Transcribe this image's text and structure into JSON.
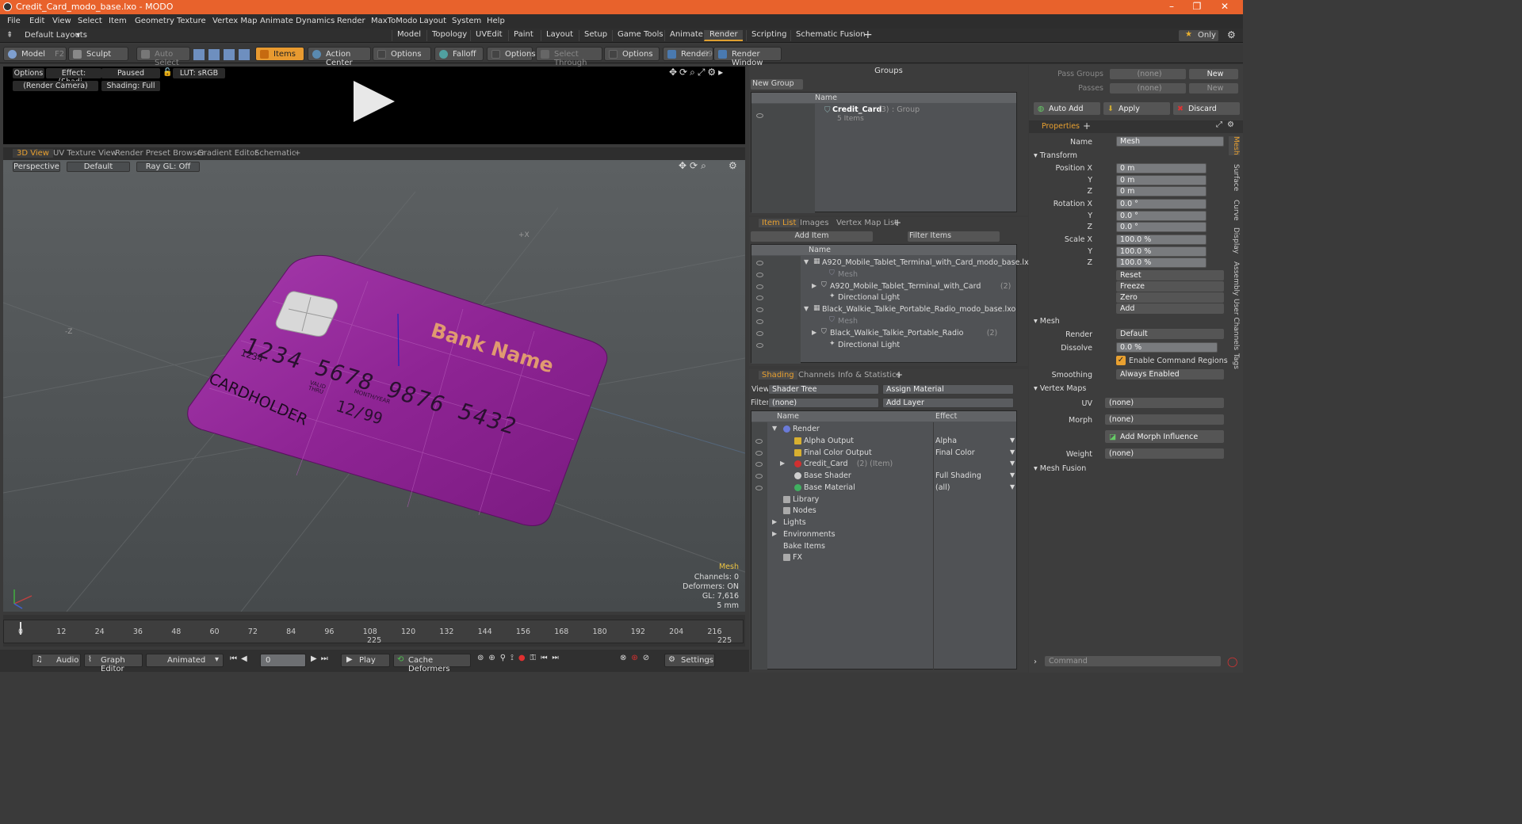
{
  "window": {
    "title": "Credit_Card_modo_base.lxo - MODO"
  },
  "menu": [
    "File",
    "Edit",
    "View",
    "Select",
    "Item",
    "Geometry",
    "Texture",
    "Vertex Map",
    "Animate",
    "Dynamics",
    "Render",
    "MaxToModo",
    "Layout",
    "System",
    "Help"
  ],
  "layout": {
    "preset": "Default Layouts",
    "tabs": [
      "Model",
      "Topology",
      "UVEdit",
      "Paint",
      "Layout",
      "Setup",
      "Game Tools",
      "Animate",
      "Render",
      "Scripting",
      "Schematic Fusion"
    ],
    "active_tab": "Render",
    "only_label": "Only"
  },
  "toolbar": {
    "model": "Model",
    "model_key": "F2",
    "sculpt": "Sculpt",
    "auto_select": "Auto Select",
    "items": "Items",
    "action_center": "Action Center",
    "options1": "Options",
    "falloff": "Falloff",
    "options2": "Options",
    "select_through": "Select Through",
    "options3": "Options",
    "render": "Render",
    "render_key": "F9",
    "render_window": "Render Window"
  },
  "preview": {
    "options": "Options",
    "effect": "Effect: (Shadi...",
    "paused": "Paused",
    "lut": "LUT: sRGB",
    "camera": "(Render Camera)",
    "shading": "Shading: Full"
  },
  "viewport_tabs": [
    "3D View",
    "UV Texture View",
    "Render Preset Browser",
    "Gradient Editor",
    "Schematic"
  ],
  "viewport": {
    "perspective": "Perspective",
    "default": "Default",
    "raygl": "Ray GL: Off",
    "card": {
      "bank": "Bank Name",
      "number": "1234 5678 9876 5432",
      "small": "1234",
      "valid": "VALID\nTHRU",
      "expiry_label": "MONTH/YEAR",
      "expiry": "12/99",
      "holder": "CARDHOLDER",
      "color": "#9a2aa0"
    },
    "stats": {
      "type": "Mesh",
      "channels": "Channels: 0",
      "deformers": "Deformers: ON",
      "gl": "GL: 7,616",
      "unit": "5 mm"
    }
  },
  "timeline": {
    "ticks": [
      "0",
      "12",
      "24",
      "36",
      "48",
      "60",
      "72",
      "84",
      "96",
      "108",
      "120",
      "132",
      "144",
      "156",
      "168",
      "180",
      "192",
      "204",
      "216"
    ],
    "mid": "225",
    "end": "225"
  },
  "bottom": {
    "audio": "Audio",
    "graph": "Graph Editor",
    "animated": "Animated",
    "frame": "0",
    "play": "Play",
    "cache": "Cache Deformers",
    "settings": "Settings"
  },
  "groups": {
    "title": "Groups",
    "new_group": "New Group",
    "col": "Name",
    "item": "Credit_Card",
    "count": "(3)",
    "type": ": Group",
    "items": "5 Items"
  },
  "itemlist": {
    "tabs": [
      "Item List",
      "Images",
      "Vertex Map List"
    ],
    "add_item": "Add Item",
    "filter": "Filter Items",
    "col": "Name",
    "rows": [
      {
        "label": "A920_Mobile_Tablet_Terminal_with_Card_modo_base.lxo",
        "indent": 0
      },
      {
        "label": "Mesh",
        "indent": 2,
        "dim": true
      },
      {
        "label": "A920_Mobile_Tablet_Terminal_with_Card",
        "extra": "(2)",
        "indent": 1
      },
      {
        "label": "Directional Light",
        "indent": 2
      },
      {
        "label": "Black_Walkie_Talkie_Portable_Radio_modo_base.lxo",
        "indent": 0
      },
      {
        "label": "Mesh",
        "indent": 2,
        "dim": true
      },
      {
        "label": "Black_Walkie_Talkie_Portable_Radio",
        "extra": "(2)",
        "indent": 1
      },
      {
        "label": "Directional Light",
        "indent": 2
      }
    ]
  },
  "shading": {
    "tabs": [
      "Shading",
      "Channels",
      "Info & Statistics"
    ],
    "view_label": "View",
    "view": "Shader Tree",
    "assign": "Assign Material",
    "filter_label": "Filter",
    "filter": "(none)",
    "add_layer": "Add Layer",
    "col_name": "Name",
    "col_effect": "Effect",
    "rows": [
      {
        "label": "Render",
        "effect": "",
        "indent": 0
      },
      {
        "label": "Alpha Output",
        "effect": "Alpha",
        "indent": 1
      },
      {
        "label": "Final Color Output",
        "effect": "Final Color",
        "indent": 1
      },
      {
        "label": "Credit_Card",
        "extra": "(2) (Item)",
        "effect": "",
        "indent": 1
      },
      {
        "label": "Base Shader",
        "effect": "Full Shading",
        "indent": 1
      },
      {
        "label": "Base Material",
        "effect": "(all)",
        "indent": 1
      },
      {
        "label": "Library",
        "effect": "",
        "indent": 0
      },
      {
        "label": "Nodes",
        "effect": "",
        "indent": 0
      },
      {
        "label": "Lights",
        "effect": "",
        "indent": -1
      },
      {
        "label": "Environments",
        "effect": "",
        "indent": -1
      },
      {
        "label": "Bake Items",
        "effect": "",
        "indent": -1
      },
      {
        "label": "FX",
        "effect": "",
        "indent": 0
      }
    ]
  },
  "properties": {
    "pass_groups": "Pass Groups",
    "passes": "Passes",
    "none": "(none)",
    "new": "New",
    "auto_add": "Auto Add",
    "apply": "Apply",
    "discard": "Discard",
    "tab": "Properties",
    "name_label": "Name",
    "name": "Mesh",
    "transform": "Transform",
    "pos_label": "Position X",
    "rot_label": "Rotation X",
    "scale_label": "Scale X",
    "y": "Y",
    "z": "Z",
    "pos": [
      "0 m",
      "0 m",
      "0 m"
    ],
    "rot": [
      "0.0 °",
      "0.0 °",
      "0.0 °"
    ],
    "scale": [
      "100.0 %",
      "100.0 %",
      "100.0 %"
    ],
    "reset": "Reset",
    "freeze": "Freeze",
    "zero": "Zero",
    "add": "Add",
    "mesh": "Mesh",
    "render_label": "Render",
    "render": "Default",
    "dissolve_label": "Dissolve",
    "dissolve": "0.0 %",
    "enable_cmd": "Enable Command Regions",
    "smoothing_label": "Smoothing",
    "smoothing": "Always Enabled",
    "vertex_maps": "Vertex Maps",
    "uv_label": "UV",
    "uv": "(none)",
    "morph_label": "Morph",
    "morph": "(none)",
    "add_morph": "Add Morph Influence",
    "weight_label": "Weight",
    "weight": "(none)",
    "mesh_fusion": "Mesh Fusion",
    "command": "Command",
    "side_tabs": [
      "Mesh",
      "Surface",
      "Curve",
      "Display",
      "Assembly",
      "User Channels",
      "Tags"
    ]
  }
}
